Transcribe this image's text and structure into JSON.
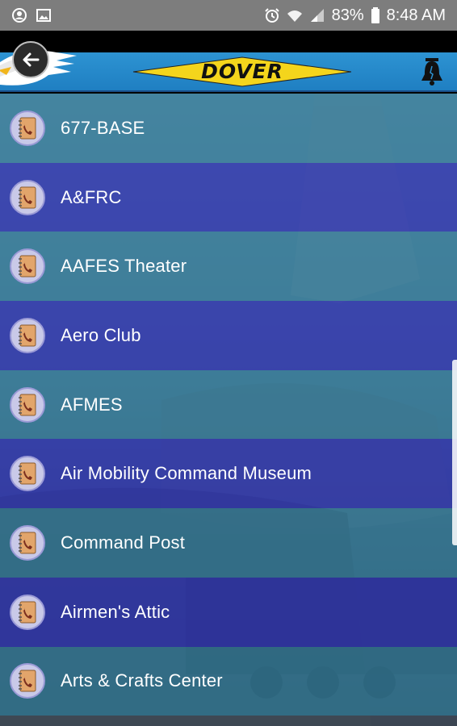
{
  "status_bar": {
    "battery": "83%",
    "time": "8:48 AM",
    "icons": [
      "account-circle-icon",
      "image-icon",
      "alarm-icon",
      "wifi-icon",
      "signal-icon",
      "battery-icon"
    ]
  },
  "header": {
    "brand": "DOVER",
    "back_icon": "arrow-left-icon",
    "logo_icon": "eagle-logo",
    "bell_icon": "liberty-bell-icon"
  },
  "contacts": [
    {
      "label": "677-BASE",
      "icon": "phone-book-icon"
    },
    {
      "label": "A&FRC",
      "icon": "phone-book-icon"
    },
    {
      "label": "AAFES Theater",
      "icon": "phone-book-icon"
    },
    {
      "label": "Aero Club",
      "icon": "phone-book-icon"
    },
    {
      "label": "AFMES",
      "icon": "phone-book-icon"
    },
    {
      "label": "Air Mobility Command Museum",
      "icon": "phone-book-icon"
    },
    {
      "label": "Command Post",
      "icon": "phone-book-icon"
    },
    {
      "label": "Airmen's Attic",
      "icon": "phone-book-icon"
    },
    {
      "label": "Arts & Crafts Center",
      "icon": "phone-book-icon"
    }
  ],
  "colors": {
    "header_blue": "#2d93d2",
    "banner_yellow": "#f4d51c",
    "row_teal": "#307692",
    "row_indigo": "#2d32aa"
  }
}
